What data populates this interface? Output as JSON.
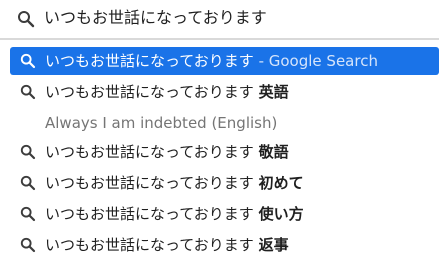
{
  "search": {
    "query": "いつもお世話になっております",
    "icon": "search-icon"
  },
  "suggestions": [
    {
      "query": "いつもお世話になっております",
      "suffix": " - Google Search",
      "selected": true
    },
    {
      "query": "いつもお世話になっております",
      "bold": "英語"
    },
    {
      "subtext": "Always I am indebted (English)"
    },
    {
      "query": "いつもお世話になっております",
      "bold": "敬語"
    },
    {
      "query": "いつもお世話になっております",
      "bold": "初めて"
    },
    {
      "query": "いつもお世話になっております",
      "bold": "使い方"
    },
    {
      "query": "いつもお世話になっております",
      "bold": "返事"
    }
  ],
  "colors": {
    "highlight": "#1a73e8",
    "subtext": "#757575",
    "suffix": "#d5e4fb"
  }
}
